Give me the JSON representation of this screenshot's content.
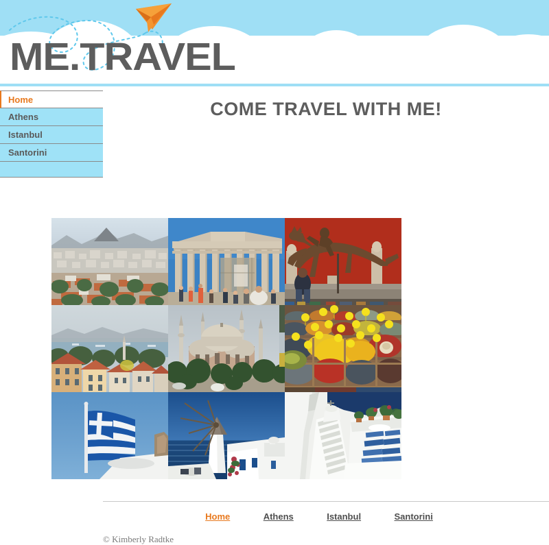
{
  "site": {
    "logo_text": "ME.TRAVEL",
    "logo_color": "#5d5d5d",
    "header_sky_color": "#9fdff5",
    "accent_color": "#e8791e",
    "nav_bg_color": "#9fe2f7",
    "plane_icon": "paper-plane-icon"
  },
  "sidebar": {
    "items": [
      {
        "label": "Home",
        "active": true
      },
      {
        "label": "Athens",
        "active": false
      },
      {
        "label": "Istanbul",
        "active": false
      },
      {
        "label": "Santorini",
        "active": false
      }
    ]
  },
  "main": {
    "title": "COME TRAVEL WITH ME!",
    "gallery": [
      {
        "alt": "Athens cityscape panorama with Lycabettus Hill",
        "city": "Athens"
      },
      {
        "alt": "The Parthenon on the Acropolis with tourists",
        "city": "Athens"
      },
      {
        "alt": "Bronze horse and jockey statue on red museum wall",
        "city": "Athens"
      },
      {
        "alt": "Istanbul Bosphorus view with terracotta rooftops",
        "city": "Istanbul"
      },
      {
        "alt": "Hagia Sophia dome and minarets",
        "city": "Istanbul"
      },
      {
        "alt": "Spice bazaar with colorful spice mounds",
        "city": "Istanbul"
      },
      {
        "alt": "Greek flag waving over white building",
        "city": "Santorini"
      },
      {
        "alt": "Santorini windmill above the blue Aegean sea",
        "city": "Santorini"
      },
      {
        "alt": "White Santorini stairway and terrace with blue loungers",
        "city": "Santorini"
      }
    ]
  },
  "footer": {
    "links": [
      {
        "label": "Home",
        "active": true
      },
      {
        "label": "Athens",
        "active": false
      },
      {
        "label": "Istanbul",
        "active": false
      },
      {
        "label": "Santorini",
        "active": false
      }
    ],
    "copyright": "© Kimberly Radtke"
  }
}
